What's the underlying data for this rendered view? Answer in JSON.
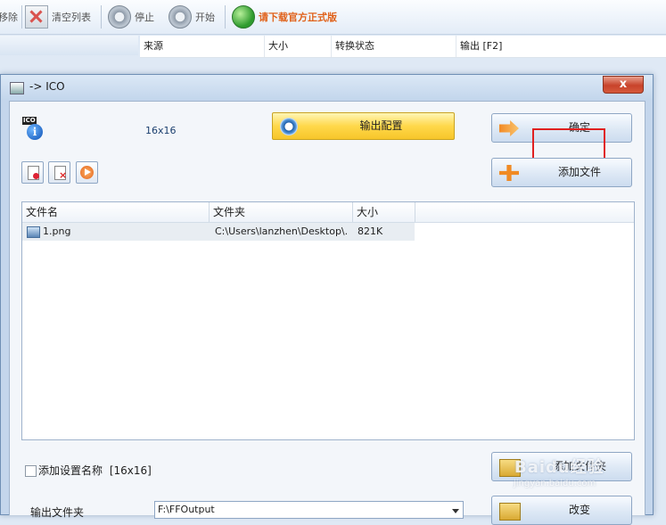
{
  "toolbar": {
    "remove_label": "移除",
    "clear_label": "清空列表",
    "stop_label": "停止",
    "start_label": "开始",
    "download_label": "请下载官方正式版"
  },
  "list_header": {
    "columns": [
      "来源",
      "大小",
      "转换状态",
      "输出 [F2]"
    ]
  },
  "dialog": {
    "title": "-> ICO",
    "close": "x",
    "format_badge": "ICO",
    "size_text": "16x16",
    "output_config_button": "输出配置",
    "ok_button": "确定",
    "add_file_button": "添加文件",
    "add_folder_button": "添加文件夹",
    "change_button": "改变",
    "grid": {
      "columns": [
        "文件名",
        "文件夹",
        "大小"
      ],
      "rows": [
        {
          "name": "1.png",
          "folder": "C:\\Users\\lanzhen\\Desktop\\...",
          "size": "821K"
        }
      ]
    },
    "add_setting_name_label": "添加设置名称",
    "add_setting_value": "[16x16]",
    "output_folder_label": "输出文件夹",
    "output_folder_value": "F:\\FFOutput"
  },
  "watermark": {
    "text": "Baidu经验",
    "url": "jingyan.baidu.com"
  },
  "colors": {
    "accent_link": "#e0621a",
    "highlight_box": "#e02020",
    "dialog_frame": "#c4d6ec"
  }
}
